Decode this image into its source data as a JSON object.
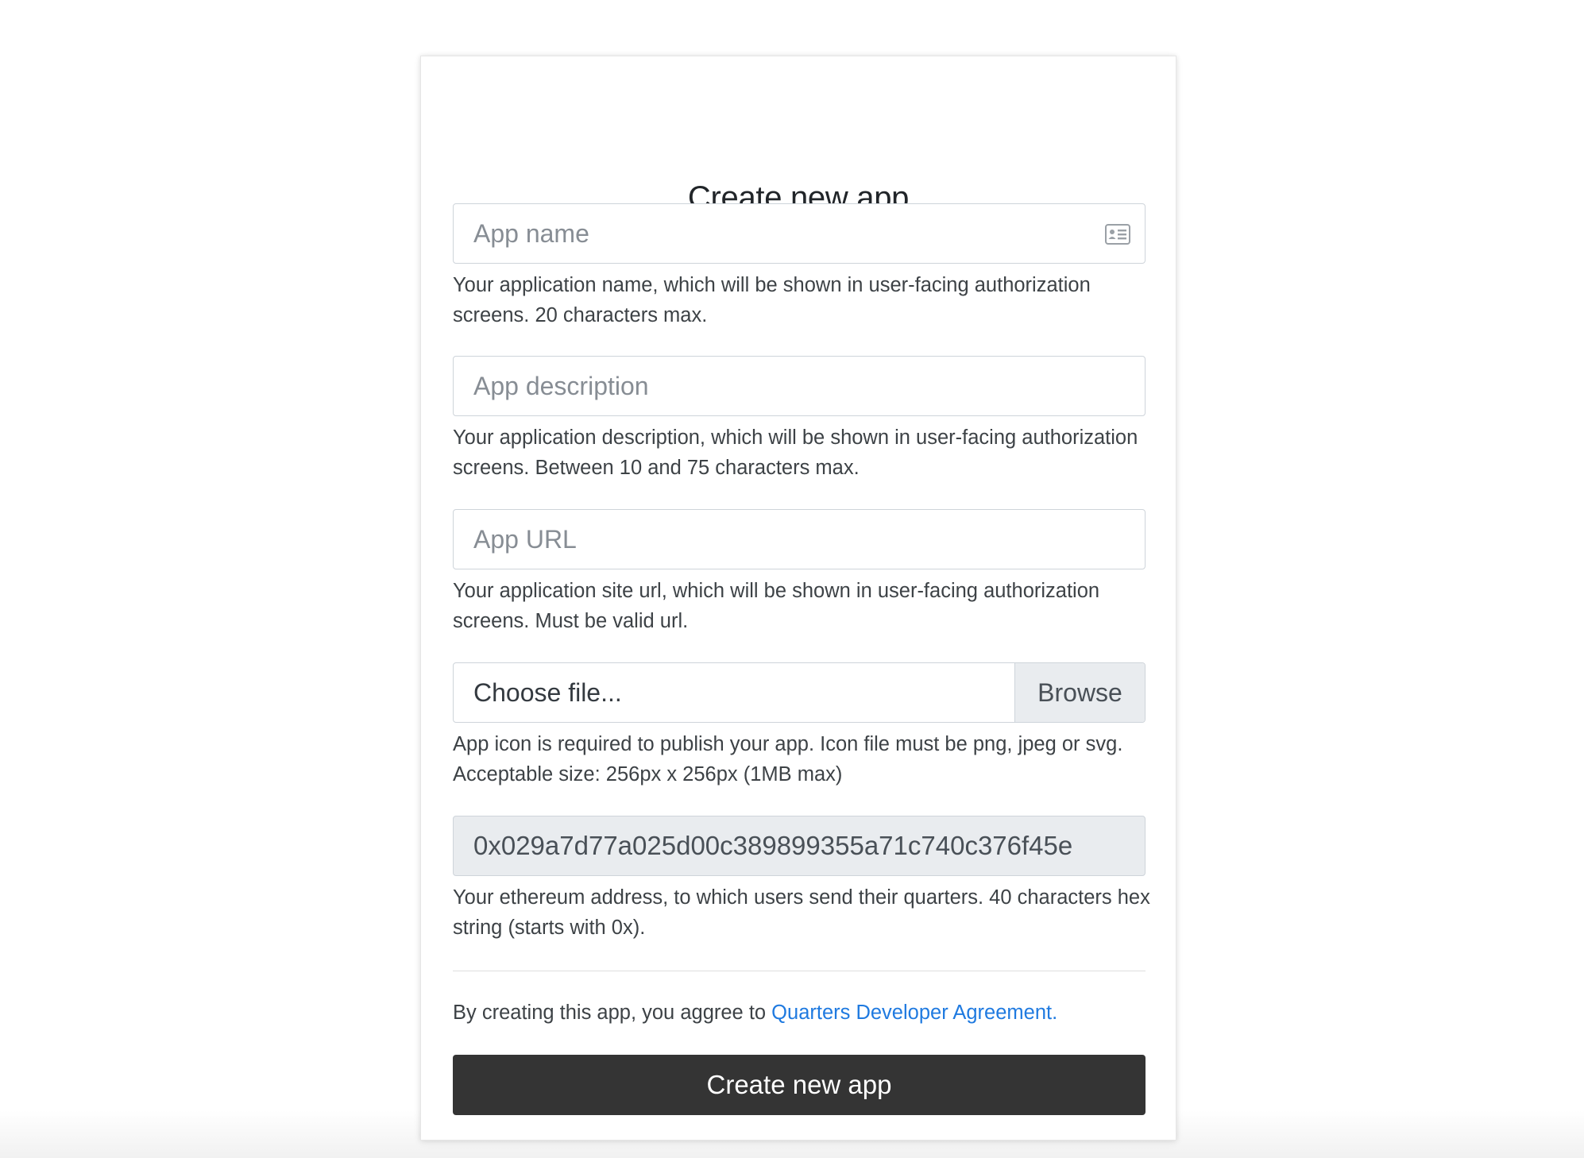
{
  "form": {
    "title": "Create new app",
    "app_name": {
      "placeholder": "App name",
      "value": "",
      "help": "Your application name, which will be shown in user-facing authorization screens. 20 characters max.",
      "icon": "contact-card-icon"
    },
    "app_description": {
      "placeholder": "App description",
      "value": "",
      "help": "Your application description, which will be shown in user-facing authorization screens. Between 10 and 75 characters max."
    },
    "app_url": {
      "placeholder": "App URL",
      "value": "",
      "help": "Your application site url, which will be shown in user-facing authorization screens. Must be valid url."
    },
    "app_icon": {
      "label": "Choose file...",
      "browse_label": "Browse",
      "help": "App icon is required to publish your app. Icon file must be png, jpeg or svg. Acceptable size: 256px x 256px (1MB max)"
    },
    "eth_address": {
      "value": "0x029a7d77a025d00c389899355a71c740c376f45e",
      "help": "Your ethereum address, to which users send their quarters. 40 characters hex string (starts with 0x)."
    },
    "agreement": {
      "text": "By creating this app, you aggree to ",
      "link_text": "Quarters Developer Agreement."
    },
    "submit_label": "Create new app"
  },
  "colors": {
    "submit_bg": "#343434",
    "link": "#1f7ae0",
    "readonly_bg": "#e9ecef"
  }
}
